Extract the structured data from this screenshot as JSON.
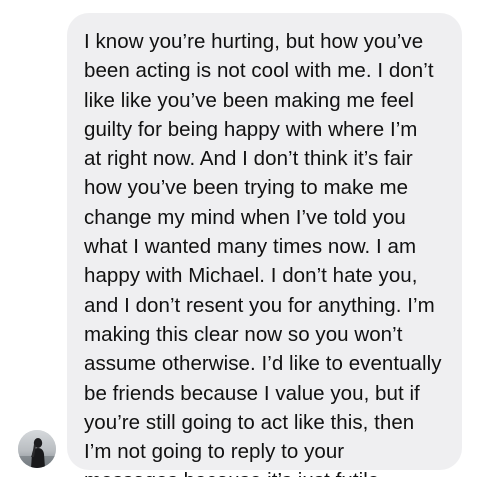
{
  "message": {
    "lines": [
      "I know you’re hurting, but how you’ve",
      "been acting is not cool with me. I don’t",
      "like like you’ve been making me feel",
      "guilty for being happy with where I’m",
      "at right now. And I don’t think it’s fair",
      "how you’ve been trying to make me",
      "change my mind when I’ve told you",
      "what I wanted many times now. I am",
      "happy with Michael. I don’t hate you,",
      "and I don’t resent you for anything. I’m",
      "making this clear now so you won’t",
      "assume otherwise. I’d like to eventually",
      "be friends because I value you, but if",
      "you’re still going to act like this, then",
      "I’m not going to reply to your",
      "messages because it’s just futile"
    ]
  },
  "colors": {
    "bubble_background": "#efeff1",
    "text": "#111111",
    "page_background": "#ffffff"
  },
  "icons": {
    "sender_avatar": "profile-photo-icon"
  }
}
